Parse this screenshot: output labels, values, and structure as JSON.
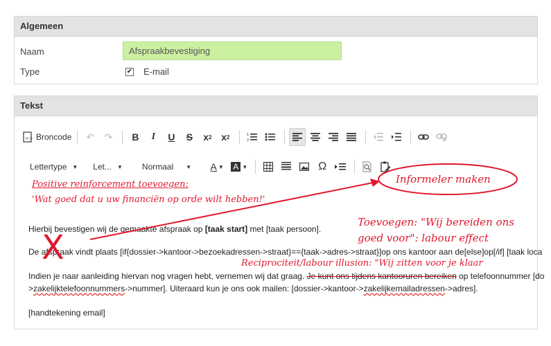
{
  "general": {
    "title": "Algemeen",
    "name_label": "Naam",
    "name_value": "Afspraakbevestiging",
    "type_label": "Type",
    "type_option": "E-mail"
  },
  "text_panel": {
    "title": "Tekst",
    "toolbar": {
      "source_label": "Broncode",
      "font_label": "Lettertype",
      "size_label": "Let...",
      "format_label": "Normaal"
    },
    "content": {
      "line1_a": "Hierbij bevestigen wij de gemaakte afspraak op ",
      "line1_b": "[taak start]",
      "line1_c": " met [taak persoon].",
      "line2": "De afspraak vindt plaats [if{dossier->kantoor->bezoekadressen->straat}=={taak->adres->straat}]op ons kantoor aan de[else]op[/if] [taak loca",
      "line3_a": "Indien je naar aanleiding hiervan nog vragen hebt, vernemen wij dat graag. ",
      "line3_b": "Je kunt ons tijdens kantooruren bereiken",
      "line3_c": " op telefoonnummer [do",
      "line4_a": ">",
      "line4_b": "zakelijktelefoonnummers",
      "line4_c": "->nummer]. Uiteraard kun je ons ook mailen: [dossier->kantoor->",
      "line4_d": "zakelijkemailadressen",
      "line4_e": "->adres].",
      "line5": "[handtekening email]"
    }
  },
  "annotations": {
    "informal": "Informeler maken",
    "positive_1": "Positive reinforcement toevoegen:",
    "positive_2": "'Wat goed dat u uw financiën op orde wilt hebben!'",
    "labour_1": "Toevoegen: \"Wij bereiden ons",
    "labour_2": "goed voor\": labour effect",
    "reciprocity": "Reciprociteit/labour illusion: \"Wij zitten voor je klaar",
    "cross_mark": "X"
  },
  "colors": {
    "annotation": "#e0182d",
    "input_bg": "#ccf0a2",
    "panel_header": "#e3e3e3"
  }
}
